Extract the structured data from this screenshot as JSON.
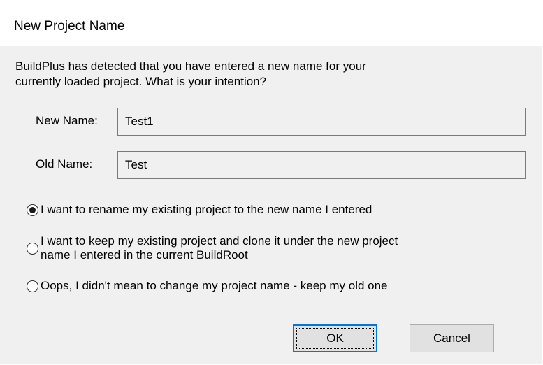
{
  "window": {
    "title": "New Project Name"
  },
  "message": {
    "line1": "BuildPlus has detected that you have entered a new name for your",
    "line2": "currently loaded project.  What is your intention?"
  },
  "fields": {
    "new_name_label": "New Name:",
    "new_name_value": "Test1",
    "old_name_label": "Old Name:",
    "old_name_value": "Test"
  },
  "options": {
    "selected_index": 0,
    "rename_label": "I want to rename my existing project to the new name I entered",
    "clone_label_line1": "I want to keep my existing project and clone it under the new project",
    "clone_label_line2": "name I entered in the current BuildRoot",
    "keep_label": "Oops, I didn't mean to change my project name - keep my old one"
  },
  "buttons": {
    "ok_label": "OK",
    "cancel_label": "Cancel"
  },
  "colors": {
    "accent": "#0078d7",
    "window_border": "#1e6bc4",
    "client_background": "#f0f0f0"
  }
}
